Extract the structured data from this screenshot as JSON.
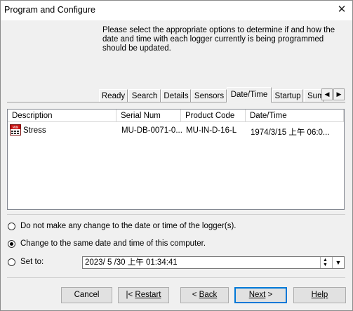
{
  "window": {
    "title": "Program and Configure",
    "close_glyph": "X"
  },
  "instructions": "Please select the appropriate options to determine if and how the date and time with each logger currently is being programmed should be updated.",
  "tabs": [
    {
      "label": "Ready",
      "active": false
    },
    {
      "label": "Search",
      "active": false
    },
    {
      "label": "Details",
      "active": false
    },
    {
      "label": "Sensors",
      "active": false
    },
    {
      "label": "Date/Time",
      "active": true
    },
    {
      "label": "Startup",
      "active": false
    },
    {
      "label": "Sum",
      "active": false
    }
  ],
  "tab_scroll": {
    "left": "◀",
    "right": "▶"
  },
  "table": {
    "columns": [
      "Description",
      "Serial Num",
      "Product Code",
      "Date/Time"
    ],
    "rows": [
      {
        "description": "Stress",
        "serial": "MU-DB-0071-0...",
        "product": "MU-IN-D-16-L",
        "datetime": "1974/3/15 上午 06:0...",
        "icon": "logger-icon"
      }
    ]
  },
  "options": {
    "no_change": "Do not make any change to the date or time of the logger(s).",
    "same_as_computer": "Change to the same date and time of this computer.",
    "set_to": "Set to:",
    "selected": "same_as_computer",
    "set_to_value": "2023/ 5 /30  上午 01:34:41"
  },
  "buttons": {
    "cancel": "Cancel",
    "restart": "Restart",
    "back": "Back",
    "next": "Next",
    "help": "Help"
  },
  "icons": {
    "logger_icon_text": "MIN"
  }
}
